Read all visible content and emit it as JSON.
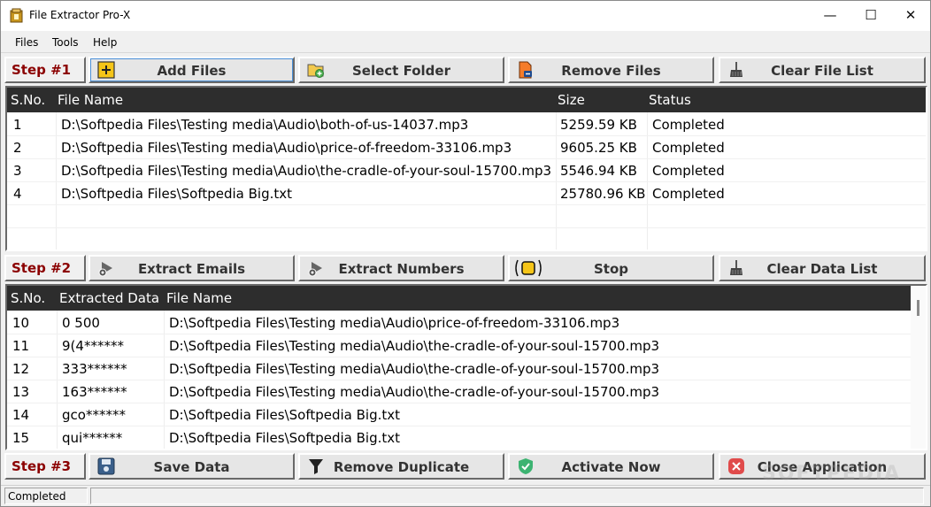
{
  "window": {
    "title": "File Extractor Pro-X",
    "controls": {
      "minimize": "—",
      "maximize": "☐",
      "close": "✕"
    }
  },
  "menu": [
    "Files",
    "Tools",
    "Help"
  ],
  "step1": {
    "label": "Step #1",
    "buttons": [
      {
        "label": "Add Files",
        "icon": "add-icon"
      },
      {
        "label": "Select Folder",
        "icon": "folder-add-icon"
      },
      {
        "label": "Remove Files",
        "icon": "file-remove-icon"
      },
      {
        "label": "Clear File List",
        "icon": "broom-icon"
      }
    ]
  },
  "files_table": {
    "columns": [
      "S.No.",
      "File Name",
      "Size",
      "Status"
    ],
    "rows": [
      [
        "1",
        "D:\\Softpedia Files\\Testing media\\Audio\\both-of-us-14037.mp3",
        "5259.59 KB",
        "Completed"
      ],
      [
        "2",
        "D:\\Softpedia Files\\Testing media\\Audio\\price-of-freedom-33106.mp3",
        "9605.25 KB",
        "Completed"
      ],
      [
        "3",
        "D:\\Softpedia Files\\Testing media\\Audio\\the-cradle-of-your-soul-15700.mp3",
        "5546.94 KB",
        "Completed"
      ],
      [
        "4",
        "D:\\Softpedia Files\\Softpedia Big.txt",
        "25780.96 KB",
        "Completed"
      ]
    ]
  },
  "step2": {
    "label": "Step #2",
    "buttons": [
      {
        "label": "Extract Emails",
        "icon": "gear-run-icon"
      },
      {
        "label": "Extract Numbers",
        "icon": "gear-run-icon"
      },
      {
        "label": "Stop",
        "icon": "stop-icon"
      },
      {
        "label": "Clear Data List",
        "icon": "broom-icon"
      }
    ]
  },
  "data_table": {
    "columns": [
      "S.No.",
      "Extracted Data",
      "File Name"
    ],
    "rows": [
      [
        "10",
        "0 500",
        "D:\\Softpedia Files\\Testing media\\Audio\\price-of-freedom-33106.mp3"
      ],
      [
        "11",
        "9(4******",
        "D:\\Softpedia Files\\Testing media\\Audio\\the-cradle-of-your-soul-15700.mp3"
      ],
      [
        "12",
        "333******",
        "D:\\Softpedia Files\\Testing media\\Audio\\the-cradle-of-your-soul-15700.mp3"
      ],
      [
        "13",
        "163******",
        "D:\\Softpedia Files\\Testing media\\Audio\\the-cradle-of-your-soul-15700.mp3"
      ],
      [
        "14",
        "gco******",
        "D:\\Softpedia Files\\Softpedia Big.txt"
      ],
      [
        "15",
        "qui******",
        "D:\\Softpedia Files\\Softpedia Big.txt"
      ]
    ]
  },
  "step3": {
    "label": "Step #3",
    "buttons": [
      {
        "label": "Save Data",
        "icon": "save-icon"
      },
      {
        "label": "Remove Duplicate",
        "icon": "filter-icon"
      },
      {
        "label": "Activate Now",
        "icon": "shield-check-icon"
      },
      {
        "label": "Close Application",
        "icon": "close-circle-icon"
      }
    ]
  },
  "statusbar": {
    "text": "Completed"
  },
  "watermark": "SOFTPEDIA",
  "colors": {
    "step_label": "#8b0000",
    "grid_header": "#2d2d2d",
    "add_icon": "#f5c518",
    "close_icon": "#e04b4b",
    "shield_icon": "#3cb371"
  }
}
